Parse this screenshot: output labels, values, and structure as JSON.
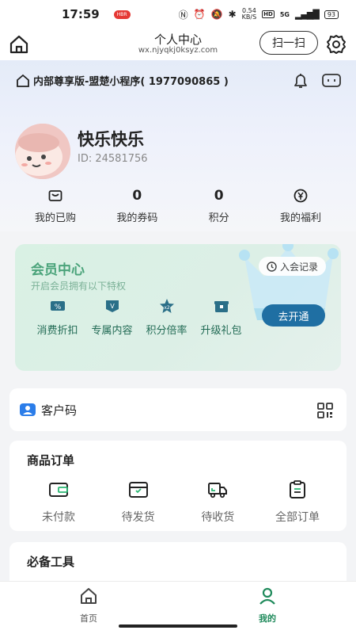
{
  "status_bar": {
    "time": "17:59",
    "badge": "HBR",
    "net_speed": "0.54",
    "net_unit": "KB/S",
    "hd": "HD",
    "signal": "5G",
    "battery": "93"
  },
  "nav": {
    "title": "个人中心",
    "subtitle": "wx.njyqkj0ksyz.com",
    "scan_label": "扫一扫"
  },
  "program": {
    "name": "内部尊享版-盟楚小程序( 1977090865 )"
  },
  "profile": {
    "name": "快乐快乐",
    "id": "ID: 24581756"
  },
  "stats": [
    {
      "value": "",
      "label": "我的已购",
      "icon": "bag-icon"
    },
    {
      "value": "0",
      "label": "我的券码",
      "icon": ""
    },
    {
      "value": "0",
      "label": "积分",
      "icon": ""
    },
    {
      "value": "",
      "label": "我的福利",
      "icon": "yen-icon"
    }
  ],
  "membership": {
    "title": "会员中心",
    "desc": "开启会员拥有以下特权",
    "record_label": "入会记录",
    "open_label": "去开通",
    "perks": [
      {
        "label": "消费折扣",
        "icon": "discount-icon",
        "glyph": "%"
      },
      {
        "label": "专属内容",
        "icon": "vip-icon",
        "glyph": "V"
      },
      {
        "label": "积分倍率",
        "icon": "star-multiplier-icon",
        "glyph": "x2"
      },
      {
        "label": "升级礼包",
        "icon": "gift-box-icon",
        "glyph": ""
      }
    ]
  },
  "customer_code": {
    "label": "客户码"
  },
  "orders": {
    "title": "商品订单",
    "items": [
      {
        "label": "未付款",
        "icon": "wallet-icon"
      },
      {
        "label": "待发货",
        "icon": "package-icon"
      },
      {
        "label": "待收货",
        "icon": "truck-icon"
      },
      {
        "label": "全部订单",
        "icon": "clipboard-icon"
      }
    ]
  },
  "tools": {
    "title": "必备工具"
  },
  "tabbar": [
    {
      "label": "首页",
      "icon": "home-icon"
    },
    {
      "label": "我的",
      "icon": "profile-icon"
    }
  ],
  "colors": {
    "accent_green": "#1f8a5b",
    "member_green": "#4aa37a",
    "button_blue": "#1f6fa3"
  }
}
